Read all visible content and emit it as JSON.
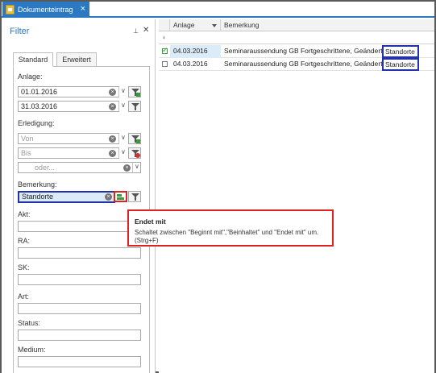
{
  "window": {
    "tab_title": "Dokumenteintrag",
    "tab_close": "×",
    "accent": "#2b79c2"
  },
  "filter": {
    "title": "Filter",
    "pin": "⊥",
    "close": "✕",
    "tabs": [
      {
        "label": "Standard",
        "active": true
      },
      {
        "label": "Erweitert",
        "active": false
      }
    ],
    "anlage": {
      "label": "Anlage:",
      "from": "01.01.2016",
      "to": "31.03.2016"
    },
    "erledigung": {
      "label": "Erledigung:",
      "from_placeholder": "Von",
      "to_placeholder": "Bis",
      "or_placeholder": "oder..."
    },
    "bemerkung": {
      "label": "Bemerkung:",
      "value": "Standorte"
    },
    "fields": [
      {
        "label": "Akt:"
      },
      {
        "label": "RA:"
      },
      {
        "label": "SK:"
      },
      {
        "label": "Art:"
      },
      {
        "label": "Status:"
      },
      {
        "label": "Medium:"
      }
    ],
    "icons": {
      "clear": "clear-icon",
      "dropdown": "chevron-down-icon",
      "filter": "filter-icon",
      "mode_switch": "match-mode-icon"
    }
  },
  "grid": {
    "columns": [
      "Anlage",
      "Bemerkung"
    ],
    "filter_row_icon": "pin-icon",
    "rows": [
      {
        "checked": true,
        "anlage": "04.03.2016",
        "bemerkung": "Seminaraussendung GB Fortgeschrittene, Geänderte",
        "match": "Standorte"
      },
      {
        "checked": false,
        "anlage": "04.03.2016",
        "bemerkung": "Seminaraussendung GB Fortgeschrittene, Geänderte",
        "match": "Standorte"
      }
    ]
  },
  "tooltip": {
    "title": "Endet mit",
    "text": "Schaltet zwischen \"Beginnt mit\",\"Beinhaltet\" und \"Endet mit\" um. (Strg+F)"
  },
  "colors": {
    "highlight_border": "#2233aa",
    "callout_border": "#dd2222",
    "selection": "#dcebf8"
  }
}
